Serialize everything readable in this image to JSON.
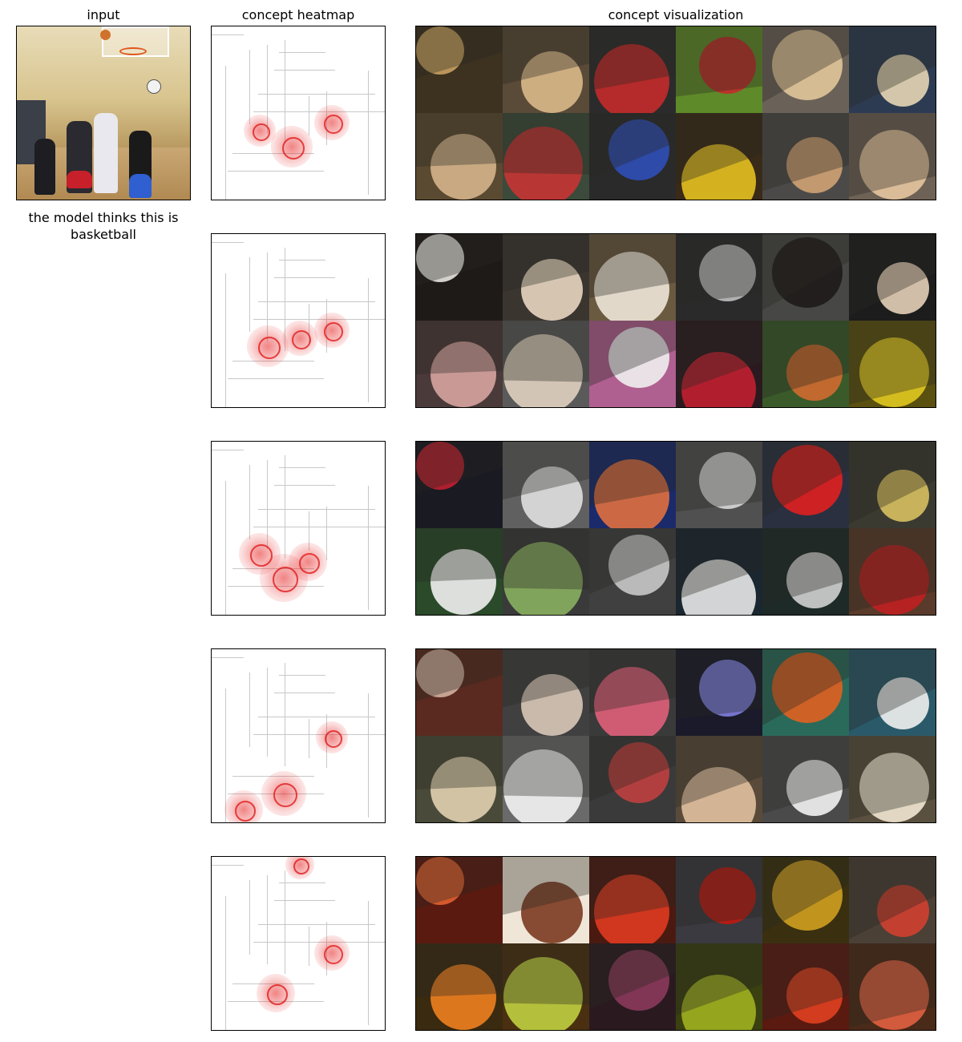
{
  "headers": {
    "input": "input",
    "heatmap": "concept heatmap",
    "visualization": "concept visualization"
  },
  "caption": "the model thinks this is basketball",
  "rows": [
    {
      "tiles": [
        [
          "#3d3220",
          "#c8a060"
        ],
        [
          "#5a4a38",
          "#d9b98a"
        ],
        [
          "#2b2b2b",
          "#c42a2a"
        ],
        [
          "#5e8a2a",
          "#c22a2a"
        ],
        [
          "#6a6258",
          "#e2c79a"
        ],
        [
          "#2d3b52",
          "#e6d6b4"
        ],
        [
          "#5b4a32",
          "#d4b489"
        ],
        [
          "#3b4a3a",
          "#c73434"
        ],
        [
          "#2a2a2a",
          "#2f4fb8"
        ],
        [
          "#3a2a18",
          "#e6c020"
        ],
        [
          "#4c4a48",
          "#d0a273"
        ],
        [
          "#6e6256",
          "#e6c7a0"
        ]
      ]
    },
    {
      "tiles": [
        [
          "#1e1a18",
          "#e8e6e0"
        ],
        [
          "#3b3530",
          "#e8d6c0"
        ],
        [
          "#6a5a40",
          "#f0e6d8"
        ],
        [
          "#2a2a2a",
          "#bfbfbf"
        ],
        [
          "#474745",
          "#1e1a18"
        ],
        [
          "#1c1c1c",
          "#e6d0b8"
        ],
        [
          "#4a3a3a",
          "#d7a4a0"
        ],
        [
          "#5a5a5a",
          "#e0d0c0"
        ],
        [
          "#b06090",
          "#f0f0f0"
        ],
        [
          "#2a1a20",
          "#c02030"
        ],
        [
          "#3a5a2a",
          "#d06a30"
        ],
        [
          "#5a5010",
          "#e0c820"
        ]
      ]
    },
    {
      "tiles": [
        [
          "#1a1a22",
          "#c02030"
        ],
        [
          "#606060",
          "#e0e0e0"
        ],
        [
          "#1a2a6a",
          "#e07040"
        ],
        [
          "#505050",
          "#d8d8d8"
        ],
        [
          "#2a3040",
          "#e02020"
        ],
        [
          "#3a3a30",
          "#d8c060"
        ],
        [
          "#2a4a2a",
          "#f0f0f0"
        ],
        [
          "#3a3a3a",
          "#8ab060"
        ],
        [
          "#404040",
          "#c8c8c8"
        ],
        [
          "#1a2630",
          "#e8e8e8"
        ],
        [
          "#1e2a28",
          "#d0d0d0"
        ],
        [
          "#5a3a2a",
          "#c02020"
        ]
      ]
    },
    {
      "tiles": [
        [
          "#5a2a20",
          "#d0b0a0"
        ],
        [
          "#404040",
          "#d8c8b8"
        ],
        [
          "#3a3a3a",
          "#e0607a"
        ],
        [
          "#1a1a2a",
          "#8080e0"
        ],
        [
          "#2a6a5a",
          "#e06020"
        ],
        [
          "#2a5a6a",
          "#f0f0f0"
        ],
        [
          "#4a4a3a",
          "#e0d0b0"
        ],
        [
          "#6a6a6a",
          "#f4f4f4"
        ],
        [
          "#3a3a3a",
          "#c04040"
        ],
        [
          "#5a4a3a",
          "#e0c0a0"
        ],
        [
          "#4a4a4a",
          "#f2f2f2"
        ],
        [
          "#5a5040",
          "#f0e6d0"
        ]
      ]
    },
    {
      "tiles": [
        [
          "#5a1a10",
          "#e06030"
        ],
        [
          "#f0e6d8",
          "#7a3a20"
        ],
        [
          "#4a1a10",
          "#e03a20"
        ],
        [
          "#3a3a40",
          "#c01a10"
        ],
        [
          "#3a3010",
          "#d0a020"
        ],
        [
          "#4a4036",
          "#d04030"
        ],
        [
          "#3a2a10",
          "#f08020"
        ],
        [
          "#4a3010",
          "#c0d040"
        ],
        [
          "#2a1a20",
          "#8a3a5a"
        ],
        [
          "#3a4010",
          "#a0b020"
        ],
        [
          "#5a1a10",
          "#e04020"
        ],
        [
          "#4a2a18",
          "#e06040"
        ]
      ]
    }
  ]
}
